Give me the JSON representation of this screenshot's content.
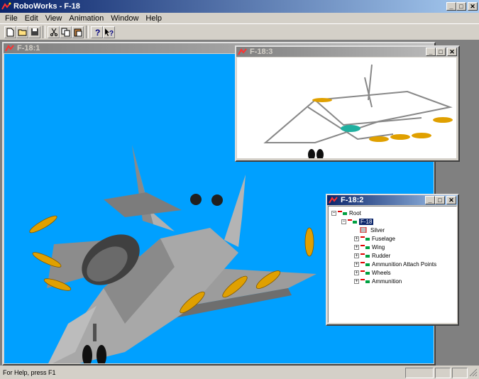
{
  "app": {
    "title": "RoboWorks - F-18",
    "menu": [
      "File",
      "Edit",
      "View",
      "Animation",
      "Window",
      "Help"
    ]
  },
  "toolbar": {
    "buttons": [
      "new-icon",
      "open-icon",
      "save-icon",
      "cut-icon",
      "copy-icon",
      "paste-icon",
      "about-icon",
      "context-help-icon"
    ]
  },
  "windows": {
    "view1_title": "F-18:1",
    "view3_title": "F-18:3",
    "tree_title": "F-18:2"
  },
  "tree": {
    "root": "Root",
    "model": "F-18",
    "material": "Silver",
    "children": [
      "Fuselage",
      "Wing",
      "Rudder",
      "Ammunition Attach Points",
      "Wheels",
      "Ammunition"
    ]
  },
  "status": {
    "text": "For Help, press F1"
  },
  "colors": {
    "viewport_bg": "#00a0ff",
    "jet_gray": "#a0a0a0",
    "missile_gold": "#e0a000",
    "selection": "#0a246a"
  }
}
